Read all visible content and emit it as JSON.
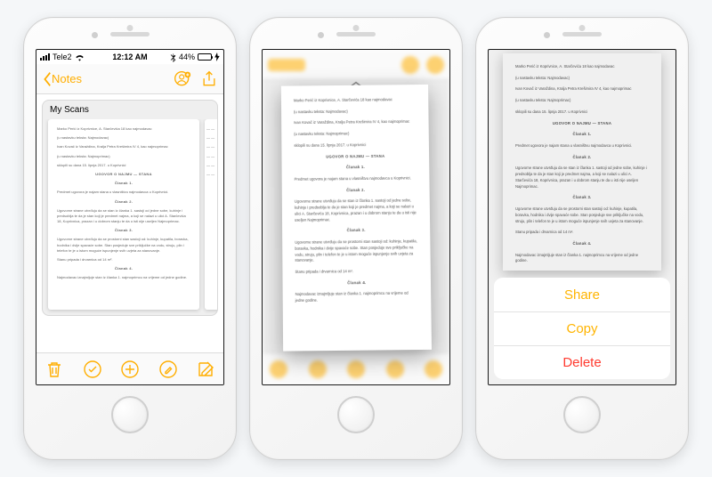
{
  "status_bar": {
    "carrier": "Tele2",
    "wifi": true,
    "time": "12:12 AM",
    "bluetooth": true,
    "battery_pct": "44%",
    "battery_fill": 44
  },
  "nav": {
    "back_label": "Notes"
  },
  "note": {
    "attachment_title": "My Scans"
  },
  "action_sheet": {
    "share": "Share",
    "copy": "Copy",
    "delete": "Delete"
  },
  "icons": {
    "back_chevron": "chevron-left-icon",
    "person_add": "person-add-icon",
    "share": "share-icon",
    "trash": "trash-icon",
    "check_circle": "check-circle-icon",
    "plus_circle": "plus-circle-icon",
    "pen_circle": "pen-circle-icon",
    "compose": "compose-icon"
  },
  "doc": {
    "line1": "Marko Perić iz Koprivnice, A. Starčevića 18 kao najmodavac",
    "line2": "(u nastavku teksta: Najmodavac)",
    "line3": "Ivan Kovač iz Varaždina, Kralja Petra Krešimira IV 4, kao najmoprimac",
    "line4": "(u nastavku teksta: Najmoprimac)",
    "line5": "sklopili su dana 15. lipnja 2017. u Koprivnici",
    "title": "UGOVOR O NAJMU — STANA",
    "article1_h": "Članak 1.",
    "article1": "Predmet ugovora je najam stana u vlasništvu najmodavca u Koprivnici.",
    "article2_h": "Članak 2.",
    "article2": "Ugovorne strane utvrđuju da se stan iz članka 1. sastoji od jedne sobe, kuhinje i predsoblja te da je stan koji je predmet najma, a koji se nalazi u ulici A. Starčevića 18, Koprivnica, prazan i u dobrom stanju te da u isti nije useljen Najmoprimac.",
    "article3_h": "Članak 3.",
    "article3": "Ugovorne strane utvrđuju da se prostorni stan sastoji od: kuhinje, kupatila, boravka, hodnika i dvije spavaće sobe. Stan posjeduje sve priključke na vodu, struju, plin i telefon te je u istom moguće ispunjenje svih uvjeta za stanovanje.",
    "article3b": "Stanu pripada i drvarnica od 14 m².",
    "article4_h": "Članak 4.",
    "article4": "Najmodavac iznajmljuje stan iz članka 1. najmoprimcu na vrijeme od jedne godine."
  }
}
